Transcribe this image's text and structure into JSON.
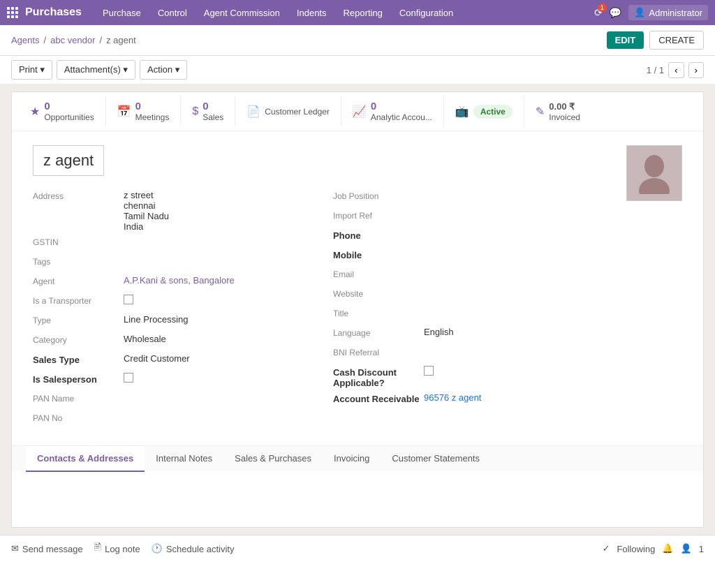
{
  "app": {
    "title": "Purchases",
    "menu": [
      "Purchase",
      "Control",
      "Agent Commission",
      "Indents",
      "Reporting",
      "Configuration"
    ],
    "user": "Administrator"
  },
  "breadcrumb": {
    "items": [
      "Agents",
      "abc vendor",
      "z agent"
    ]
  },
  "toolbar": {
    "edit_label": "EDIT",
    "create_label": "CREATE",
    "print_label": "Print",
    "attachments_label": "Attachment(s)",
    "action_label": "Action",
    "pagination": "1 / 1"
  },
  "smart_buttons": {
    "opportunities": {
      "count": "0",
      "label": "Opportunities"
    },
    "meetings": {
      "count": "0",
      "label": "Meetings"
    },
    "sales": {
      "count": "0",
      "label": "Sales"
    },
    "customer_ledger": {
      "label": "Customer\nLedger"
    },
    "analytic": {
      "count": "0",
      "label": "Analytic Accou..."
    },
    "active": {
      "label": "Active"
    },
    "invoiced": {
      "amount": "0.00 ₹",
      "label": "Invoiced"
    }
  },
  "record": {
    "name": "z agent",
    "address": {
      "street": "z street",
      "city": "chennai",
      "state": "Tamil Nadu",
      "country": "India"
    },
    "gstin_label": "GSTIN",
    "tags_label": "Tags",
    "agent_label": "Agent",
    "agent_value": "A.P.Kani & sons, Bangalore",
    "is_transporter_label": "Is a Transporter",
    "type_label": "Type",
    "type_value": "Line Processing",
    "category_label": "Category",
    "category_value": "Wholesale",
    "sales_type_label": "Sales Type",
    "sales_type_value": "Credit Customer",
    "is_salesperson_label": "Is Salesperson",
    "pan_name_label": "PAN Name",
    "pan_no_label": "PAN No",
    "job_position_label": "Job Position",
    "import_ref_label": "Import Ref",
    "phone_label": "Phone",
    "mobile_label": "Mobile",
    "email_label": "Email",
    "website_label": "Website",
    "title_label": "Title",
    "language_label": "Language",
    "language_value": "English",
    "bni_referral_label": "BNI Referral",
    "cash_discount_label": "Cash Discount\nApplicable?",
    "account_receivable_label": "Account Receivable",
    "account_receivable_value": "96576 z agent"
  },
  "tabs": {
    "items": [
      "Contacts & Addresses",
      "Internal Notes",
      "Sales & Purchases",
      "Invoicing",
      "Customer Statements"
    ],
    "active": 0
  },
  "footer": {
    "send_message": "Send message",
    "log_note": "Log note",
    "schedule_activity": "Schedule activity",
    "following": "Following",
    "followers_count": "1"
  }
}
